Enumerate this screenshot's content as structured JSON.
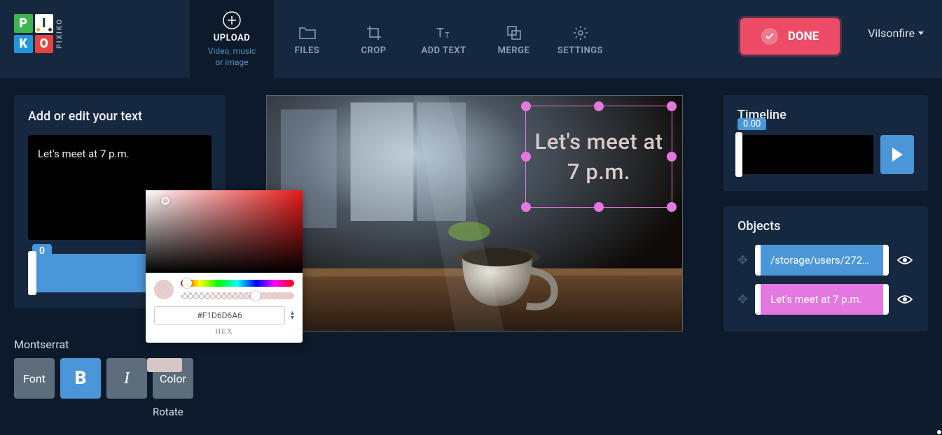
{
  "user": {
    "name": "Vilsonfire"
  },
  "toolbar": {
    "upload": {
      "label": "UPLOAD",
      "subtitle": "Video, music\nor image"
    },
    "files": "FILES",
    "crop": "CROP",
    "add_text": "ADD TEXT",
    "merge": "MERGE",
    "settings": "SETTINGS",
    "done": "DONE"
  },
  "left": {
    "title": "Add or edit your text",
    "text_value": "Let's meet at 7 p.m.",
    "slider_value": "0",
    "font_name": "Montserrat",
    "buttons": {
      "font": "Font",
      "bold": "B",
      "italic": "I",
      "color": "Color"
    },
    "rotate_label": "Rotate"
  },
  "color_picker": {
    "hex": "#F1D6D6A6",
    "hex_label": "HEX"
  },
  "canvas": {
    "overlay_text": "Let's meet at 7 p.m."
  },
  "timeline": {
    "title": "Timeline",
    "current": "0.00"
  },
  "objects": {
    "title": "Objects",
    "items": [
      {
        "label": "/storage/users/272…",
        "color": "blue"
      },
      {
        "label": "Let's meet at 7 p.m.",
        "color": "pink"
      }
    ]
  }
}
